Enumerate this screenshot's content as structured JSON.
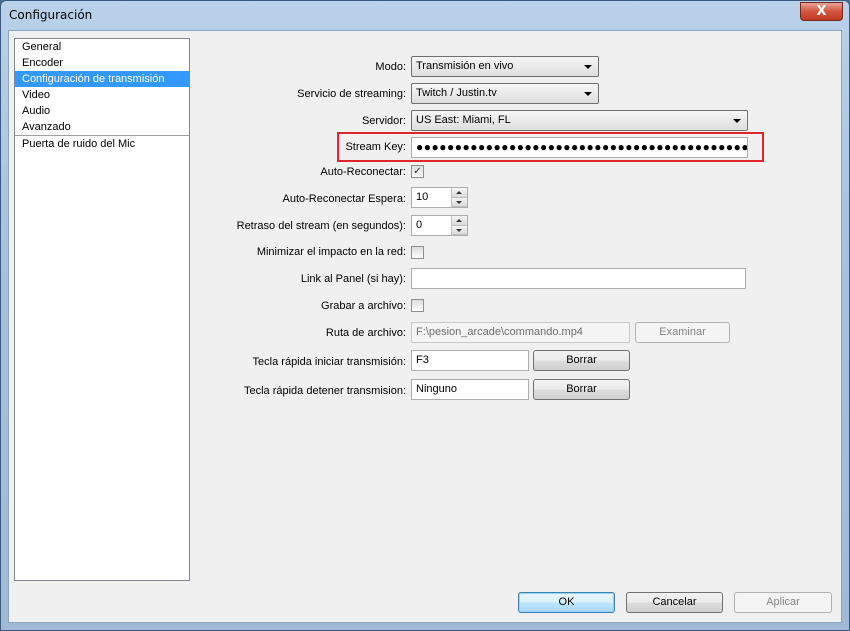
{
  "window": {
    "title": "Configuración",
    "close_glyph": "X"
  },
  "sidebar": {
    "items": [
      {
        "label": "General",
        "selected": false
      },
      {
        "label": "Encoder",
        "selected": false
      },
      {
        "label": "Configuración de transmisión",
        "selected": true
      },
      {
        "label": "Video",
        "selected": false
      },
      {
        "label": "Audio",
        "selected": false
      },
      {
        "label": "Avanzado",
        "selected": false
      }
    ],
    "sub_items": [
      {
        "label": "Puerta de ruido del Mic"
      }
    ]
  },
  "form": {
    "mode": {
      "label": "Modo:",
      "value": "Transmisión en vivo"
    },
    "service": {
      "label": "Servicio de streaming:",
      "value": "Twitch / Justin.tv"
    },
    "server": {
      "label": "Servidor:",
      "value": "US East: Miami, FL"
    },
    "stream_key": {
      "label": "Stream Key:",
      "value": "●●●●●●●●●●●●●●●●●●●●●●●●●●●●●●●●●●●●●●●●●●●●●"
    },
    "auto_reconnect": {
      "label": "Auto-Reconectar:",
      "checked": true,
      "glyph": "✓"
    },
    "auto_reconnect_wait": {
      "label": "Auto-Reconectar Espera:",
      "value": "10"
    },
    "stream_delay": {
      "label": "Retraso del stream (en segundos):",
      "value": "0"
    },
    "minimize_impact": {
      "label": "Minimizar el impacto en la red:",
      "checked": false
    },
    "dashboard_link": {
      "label": "Link al Panel (si hay):",
      "value": ""
    },
    "save_to_file": {
      "label": "Grabar a archivo:",
      "checked": false
    },
    "file_path": {
      "label": "Ruta de archivo:",
      "value": "F:\\pesion_arcade\\commando.mp4",
      "browse_label": "Examinar"
    },
    "hotkey_start": {
      "label": "Tecla rápida iniciar transmisión:",
      "value": "F3",
      "clear_label": "Borrar"
    },
    "hotkey_stop": {
      "label": "Tecla rápida detener transmision:",
      "value": "Ninguno",
      "clear_label": "Borrar"
    }
  },
  "footer": {
    "ok_label": "OK",
    "cancel_label": "Cancelar",
    "apply_label": "Aplicar"
  },
  "colors": {
    "highlight": "#e0262b",
    "selection": "#3399ff"
  }
}
